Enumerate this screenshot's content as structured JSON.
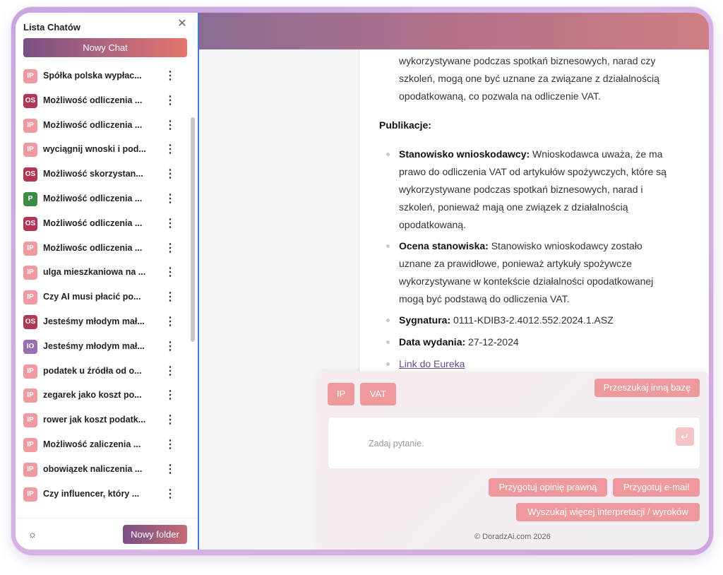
{
  "sidebar": {
    "title": "Lista Chatów",
    "new_chat_label": "Nowy Chat",
    "new_folder_label": "Nowy folder",
    "chats": [
      {
        "badge": "IP",
        "color": "#ef9aa0",
        "title": "Spółka polska wypłac..."
      },
      {
        "badge": "OS",
        "color": "#b43655",
        "title": "Możliwość odliczenia ..."
      },
      {
        "badge": "IP",
        "color": "#ef9aa0",
        "title": "Możliwość odliczenia ..."
      },
      {
        "badge": "IP",
        "color": "#ef9aa0",
        "title": "wyciągnij wnoski i pod..."
      },
      {
        "badge": "OS",
        "color": "#b43655",
        "title": "Możliwość skorzystan..."
      },
      {
        "badge": "P",
        "color": "#3d8b45",
        "title": "Możliwość odliczenia ..."
      },
      {
        "badge": "OS",
        "color": "#b43655",
        "title": "Możliwość odliczenia ..."
      },
      {
        "badge": "IP",
        "color": "#ef9aa0",
        "title": "Możliwośc odliczenia ..."
      },
      {
        "badge": "IP",
        "color": "#ef9aa0",
        "title": "ulga mieszkaniowa na ..."
      },
      {
        "badge": "IP",
        "color": "#ef9aa0",
        "title": "Czy AI musi płacić po..."
      },
      {
        "badge": "OS",
        "color": "#b43655",
        "title": "Jesteśmy młodym mał..."
      },
      {
        "badge": "IO",
        "color": "#9b6cb0",
        "title": "Jesteśmy młodym mał..."
      },
      {
        "badge": "IP",
        "color": "#ef9aa0",
        "title": "podatek u źródła od o..."
      },
      {
        "badge": "IP",
        "color": "#ef9aa0",
        "title": "zegarek jako koszt po..."
      },
      {
        "badge": "IP",
        "color": "#ef9aa0",
        "title": "rower jak koszt podatk..."
      },
      {
        "badge": "IP",
        "color": "#ef9aa0",
        "title": "Możliwość zaliczenia ..."
      },
      {
        "badge": "IP",
        "color": "#ef9aa0",
        "title": "obowiązek naliczenia ..."
      },
      {
        "badge": "IP",
        "color": "#ef9aa0",
        "title": "Czy influencer, który ..."
      }
    ]
  },
  "content": {
    "intro_lines": [
      "wykorzystywane podczas spotkań biznesowych, narad czy",
      "szkoleń, mogą one być uznane za związane z działalnością",
      "opodatkowaną, co pozwala na odliczenie VAT."
    ],
    "publications_heading": "Publikacje:",
    "position_label": "Stanowisko wnioskodawcy:",
    "position_lines": [
      "Wnioskodawca uważa, że ma",
      "prawo do odliczenia VAT od artykułów spożywczych, które są",
      "wykorzystywane podczas spotkań biznesowych, narad i",
      "szkoleń, ponieważ mają one związek z działalnością",
      "opodatkowaną."
    ],
    "assessment_label": "Ocena stanowiska:",
    "assessment_lines": [
      "Stanowisko wnioskodawcy zostało",
      "uznane za prawidłowe, ponieważ artykuły spożywcze",
      "wykorzystywane w kontekście działalności opodatkowanej",
      "mogą być podstawą do odliczenia VAT."
    ],
    "signature_label": "Sygnatura:",
    "signature_value": "0111-KDIB3-2.4012.552.2024.1.ASZ",
    "date_label": "Data wydania:",
    "date_value": "27-12-2024",
    "link_label": "Link do Eureka"
  },
  "panel": {
    "tag1": "IP",
    "tag2": "VAT",
    "search_other_label": "Przeszukaj inną bazę",
    "input_placeholder": "Zadaj pytanie.",
    "send_icon": "enter-icon",
    "opinion_label": "Przygotuj opinię prawną",
    "email_label": "Przygotuj e-mail",
    "more_label": "Wyszukaj więcej interpretacji / wyroków",
    "copyright": "© DoradzAi.com 2026"
  }
}
